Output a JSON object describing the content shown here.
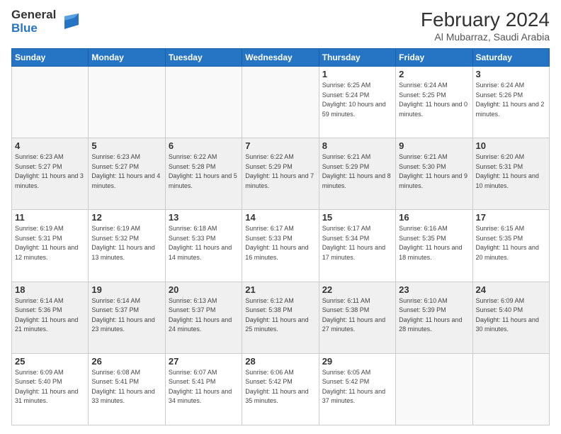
{
  "header": {
    "logo_text_general": "General",
    "logo_text_blue": "Blue",
    "title": "February 2024",
    "subtitle": "Al Mubarraz, Saudi Arabia"
  },
  "days_of_week": [
    "Sunday",
    "Monday",
    "Tuesday",
    "Wednesday",
    "Thursday",
    "Friday",
    "Saturday"
  ],
  "weeks": [
    [
      {
        "num": "",
        "info": ""
      },
      {
        "num": "",
        "info": ""
      },
      {
        "num": "",
        "info": ""
      },
      {
        "num": "",
        "info": ""
      },
      {
        "num": "1",
        "info": "Sunrise: 6:25 AM\nSunset: 5:24 PM\nDaylight: 10 hours and 59 minutes."
      },
      {
        "num": "2",
        "info": "Sunrise: 6:24 AM\nSunset: 5:25 PM\nDaylight: 11 hours and 0 minutes."
      },
      {
        "num": "3",
        "info": "Sunrise: 6:24 AM\nSunset: 5:26 PM\nDaylight: 11 hours and 2 minutes."
      }
    ],
    [
      {
        "num": "4",
        "info": "Sunrise: 6:23 AM\nSunset: 5:27 PM\nDaylight: 11 hours and 3 minutes."
      },
      {
        "num": "5",
        "info": "Sunrise: 6:23 AM\nSunset: 5:27 PM\nDaylight: 11 hours and 4 minutes."
      },
      {
        "num": "6",
        "info": "Sunrise: 6:22 AM\nSunset: 5:28 PM\nDaylight: 11 hours and 5 minutes."
      },
      {
        "num": "7",
        "info": "Sunrise: 6:22 AM\nSunset: 5:29 PM\nDaylight: 11 hours and 7 minutes."
      },
      {
        "num": "8",
        "info": "Sunrise: 6:21 AM\nSunset: 5:29 PM\nDaylight: 11 hours and 8 minutes."
      },
      {
        "num": "9",
        "info": "Sunrise: 6:21 AM\nSunset: 5:30 PM\nDaylight: 11 hours and 9 minutes."
      },
      {
        "num": "10",
        "info": "Sunrise: 6:20 AM\nSunset: 5:31 PM\nDaylight: 11 hours and 10 minutes."
      }
    ],
    [
      {
        "num": "11",
        "info": "Sunrise: 6:19 AM\nSunset: 5:31 PM\nDaylight: 11 hours and 12 minutes."
      },
      {
        "num": "12",
        "info": "Sunrise: 6:19 AM\nSunset: 5:32 PM\nDaylight: 11 hours and 13 minutes."
      },
      {
        "num": "13",
        "info": "Sunrise: 6:18 AM\nSunset: 5:33 PM\nDaylight: 11 hours and 14 minutes."
      },
      {
        "num": "14",
        "info": "Sunrise: 6:17 AM\nSunset: 5:33 PM\nDaylight: 11 hours and 16 minutes."
      },
      {
        "num": "15",
        "info": "Sunrise: 6:17 AM\nSunset: 5:34 PM\nDaylight: 11 hours and 17 minutes."
      },
      {
        "num": "16",
        "info": "Sunrise: 6:16 AM\nSunset: 5:35 PM\nDaylight: 11 hours and 18 minutes."
      },
      {
        "num": "17",
        "info": "Sunrise: 6:15 AM\nSunset: 5:35 PM\nDaylight: 11 hours and 20 minutes."
      }
    ],
    [
      {
        "num": "18",
        "info": "Sunrise: 6:14 AM\nSunset: 5:36 PM\nDaylight: 11 hours and 21 minutes."
      },
      {
        "num": "19",
        "info": "Sunrise: 6:14 AM\nSunset: 5:37 PM\nDaylight: 11 hours and 23 minutes."
      },
      {
        "num": "20",
        "info": "Sunrise: 6:13 AM\nSunset: 5:37 PM\nDaylight: 11 hours and 24 minutes."
      },
      {
        "num": "21",
        "info": "Sunrise: 6:12 AM\nSunset: 5:38 PM\nDaylight: 11 hours and 25 minutes."
      },
      {
        "num": "22",
        "info": "Sunrise: 6:11 AM\nSunset: 5:38 PM\nDaylight: 11 hours and 27 minutes."
      },
      {
        "num": "23",
        "info": "Sunrise: 6:10 AM\nSunset: 5:39 PM\nDaylight: 11 hours and 28 minutes."
      },
      {
        "num": "24",
        "info": "Sunrise: 6:09 AM\nSunset: 5:40 PM\nDaylight: 11 hours and 30 minutes."
      }
    ],
    [
      {
        "num": "25",
        "info": "Sunrise: 6:09 AM\nSunset: 5:40 PM\nDaylight: 11 hours and 31 minutes."
      },
      {
        "num": "26",
        "info": "Sunrise: 6:08 AM\nSunset: 5:41 PM\nDaylight: 11 hours and 33 minutes."
      },
      {
        "num": "27",
        "info": "Sunrise: 6:07 AM\nSunset: 5:41 PM\nDaylight: 11 hours and 34 minutes."
      },
      {
        "num": "28",
        "info": "Sunrise: 6:06 AM\nSunset: 5:42 PM\nDaylight: 11 hours and 35 minutes."
      },
      {
        "num": "29",
        "info": "Sunrise: 6:05 AM\nSunset: 5:42 PM\nDaylight: 11 hours and 37 minutes."
      },
      {
        "num": "",
        "info": ""
      },
      {
        "num": "",
        "info": ""
      }
    ]
  ]
}
